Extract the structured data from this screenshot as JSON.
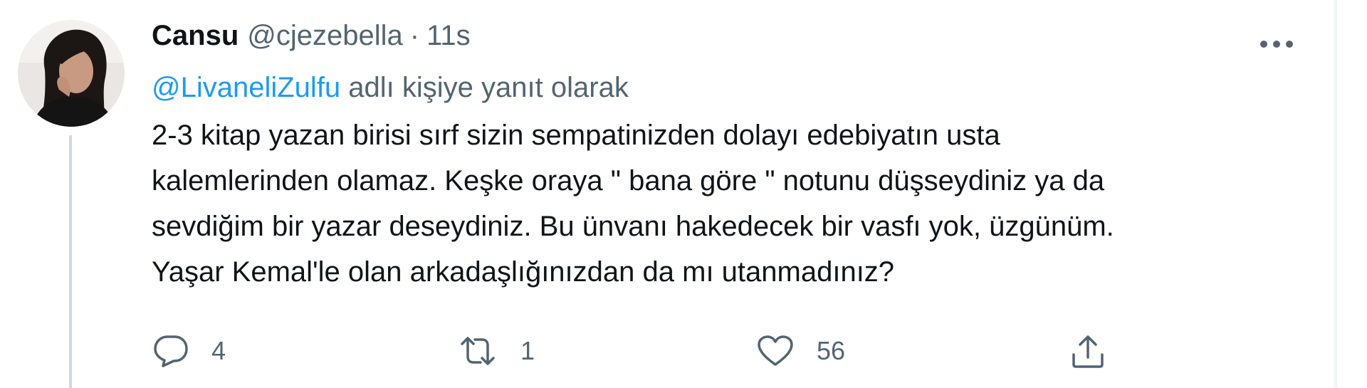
{
  "tweet": {
    "author": {
      "display_name": "Cansu",
      "handle": "@cjezebella",
      "separator": "·",
      "time": "11s",
      "avatar": "avatar-photo"
    },
    "reply": {
      "mention": "@LivaneliZulfu",
      "suffix": " adlı kişiye yanıt olarak"
    },
    "text_lines": [
      "2-3 kitap yazan birisi sırf sizin sempatinizden dolayı edebiyatın usta",
      "kalemlerinden olamaz. Keşke oraya \" bana göre \" notunu düşseydiniz ya da",
      "sevdiğim bir yazar deseydiniz. Bu ünvanı hakedecek bir vasfı yok, üzgünüm.",
      "Yaşar Kemal'le olan arkadaşlığınızdan da mı utanmadınız?"
    ],
    "actions": {
      "reply_count": "4",
      "retweet_count": "1",
      "like_count": "56"
    },
    "icons": {
      "more": "more-dots-icon",
      "reply": "reply-bubble-icon",
      "retweet": "retweet-icon",
      "like": "heart-icon",
      "share": "share-upload-icon"
    },
    "colors": {
      "link": "#1d9bf0",
      "secondary": "#536471",
      "primary": "#0f1419",
      "thread_line": "#cfd9de"
    }
  }
}
